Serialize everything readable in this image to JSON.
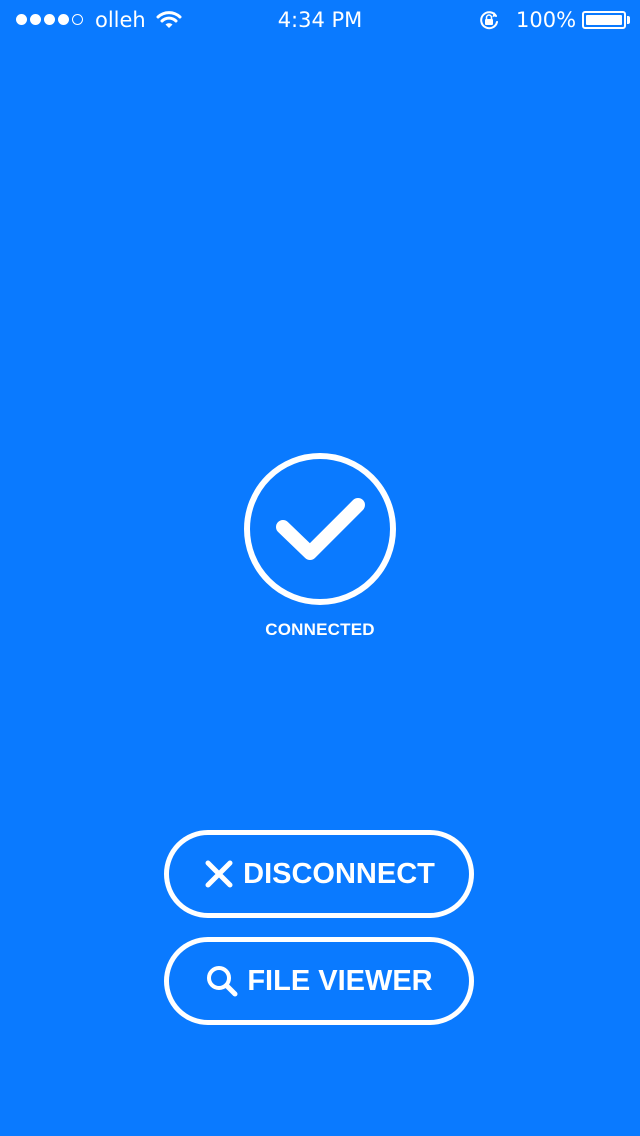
{
  "status_bar": {
    "carrier": "olleh",
    "time": "4:34 PM",
    "battery_percent": "100%",
    "signal_strength": 4,
    "signal_max": 5,
    "battery_level": 1.0
  },
  "connection": {
    "status_text": "CONNECTED",
    "icon": "check-circle-icon"
  },
  "actions": {
    "disconnect": {
      "label": "DISCONNECT",
      "icon": "close-icon"
    },
    "file_viewer": {
      "label": "FILE VIEWER",
      "icon": "search-icon"
    }
  },
  "colors": {
    "background": "#0a7aff",
    "foreground": "#ffffff"
  }
}
